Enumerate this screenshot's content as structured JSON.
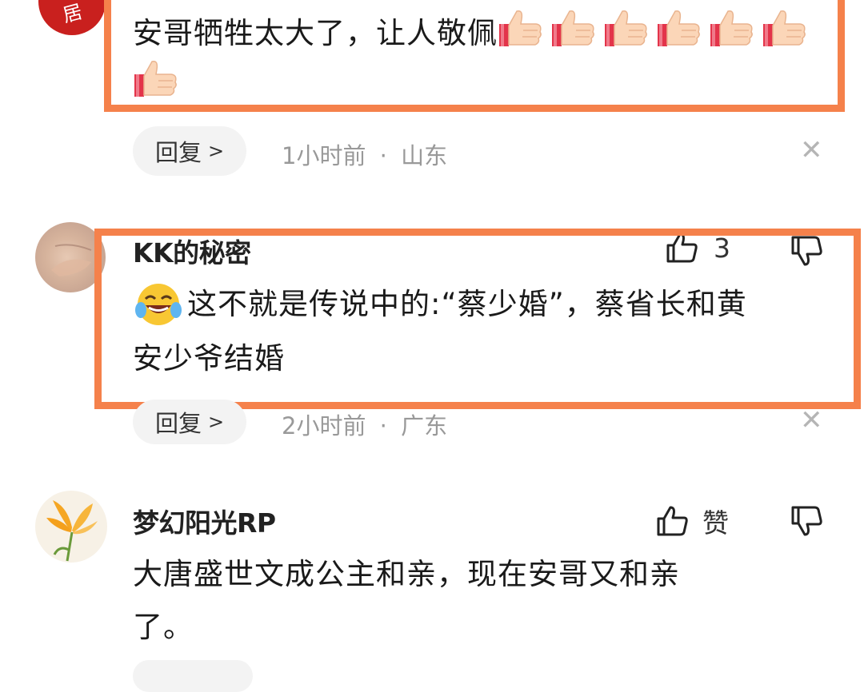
{
  "comments": [
    {
      "text": "安哥牺牲太大了，让人敬佩",
      "emoji_count": 7,
      "reply_label": "回复",
      "time": "1小时前",
      "location": "山东",
      "avatar_text": "居"
    },
    {
      "username": "KK的秘密",
      "like_count": "3",
      "text": "这不就是传说中的:“蔡少婚”，蔡省长和黄安少爷结婚",
      "text_line1": "这不就是传说中的:“蔡少婚”，蔡省长和黄",
      "text_line2": "安少爷结婚",
      "reply_label": "回复",
      "time": "2小时前",
      "location": "广东"
    },
    {
      "username": "梦幻阳光RP",
      "like_label": "赞",
      "text_line1": "大唐盛世文成公主和亲，现在安哥又和亲",
      "text_line2": "了。"
    }
  ],
  "meta_separator": "·",
  "colors": {
    "highlight": "#f5814b",
    "avatar_red": "#c9201e",
    "meta_gray": "#999999"
  },
  "icons": [
    "thumbs-up-icon",
    "thumbs-down-icon",
    "close-icon",
    "chevron-right-icon",
    "laughing-emoji-icon",
    "thumbs-up-emoji-icon"
  ]
}
